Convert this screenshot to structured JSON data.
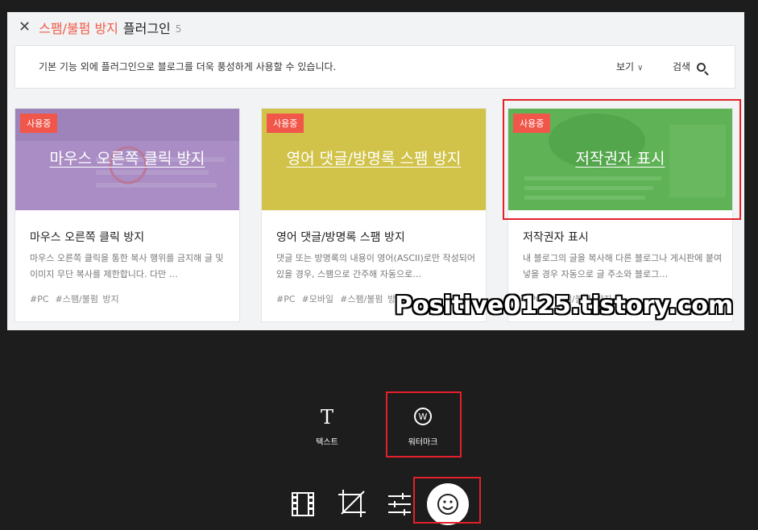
{
  "header": {
    "close_label": "✕",
    "title_highlight": "스팸/불펌 방지",
    "title_main": "플러그인",
    "count": "5"
  },
  "toolbar": {
    "description": "기본 기능 외에 플러그인으로 블로그를 더욱 풍성하게 사용할 수 있습니다.",
    "view_label": "보기",
    "search_label": "검색"
  },
  "cards": [
    {
      "badge": "사용중",
      "thumb_title": "마우스 오른쪽 클릭 방지",
      "thumb_color": "#a98dc4",
      "name": "마우스 오른쪽 클릭 방지",
      "desc": "마우스 오른쪽 클릭을 통한 복사 행위를 금지해 글 및 이미지 무단 복사를 제한합니다. 다만 …",
      "tags": [
        "#PC",
        "#스팸/불펌 방지"
      ]
    },
    {
      "badge": "사용중",
      "thumb_title": "영어 댓글/방명록 스팸 방지",
      "thumb_color": "#d1c34a",
      "name": "영어 댓글/방명록 스팸 방지",
      "desc": "댓글 또는 방명록의 내용이 영어(ASCII)로만 작성되어 있을 경우, 스팸으로 간주해 자동으로…",
      "tags": [
        "#PC",
        "#모바일",
        "#스팸/불펌 방지"
      ]
    },
    {
      "badge": "사용중",
      "thumb_title": "저작권자 표시",
      "thumb_color": "#5fb356",
      "name": "저작권자 표시",
      "desc": "내 블로그의 글을 복사해 다른 블로그나 게시판에 붙여넣을 경우 자동으로 글 주소와 블로그…",
      "tags": [
        "#PC",
        "#스팸/불펌 방지"
      ]
    }
  ],
  "watermark_text": "Positive0125.tistory.com",
  "tools": {
    "text_label": "텍스트",
    "watermark_label": "워터마크",
    "watermark_glyph": "W"
  },
  "colors": {
    "accent": "#f25c4a",
    "highlight_box": "#e3202a"
  }
}
